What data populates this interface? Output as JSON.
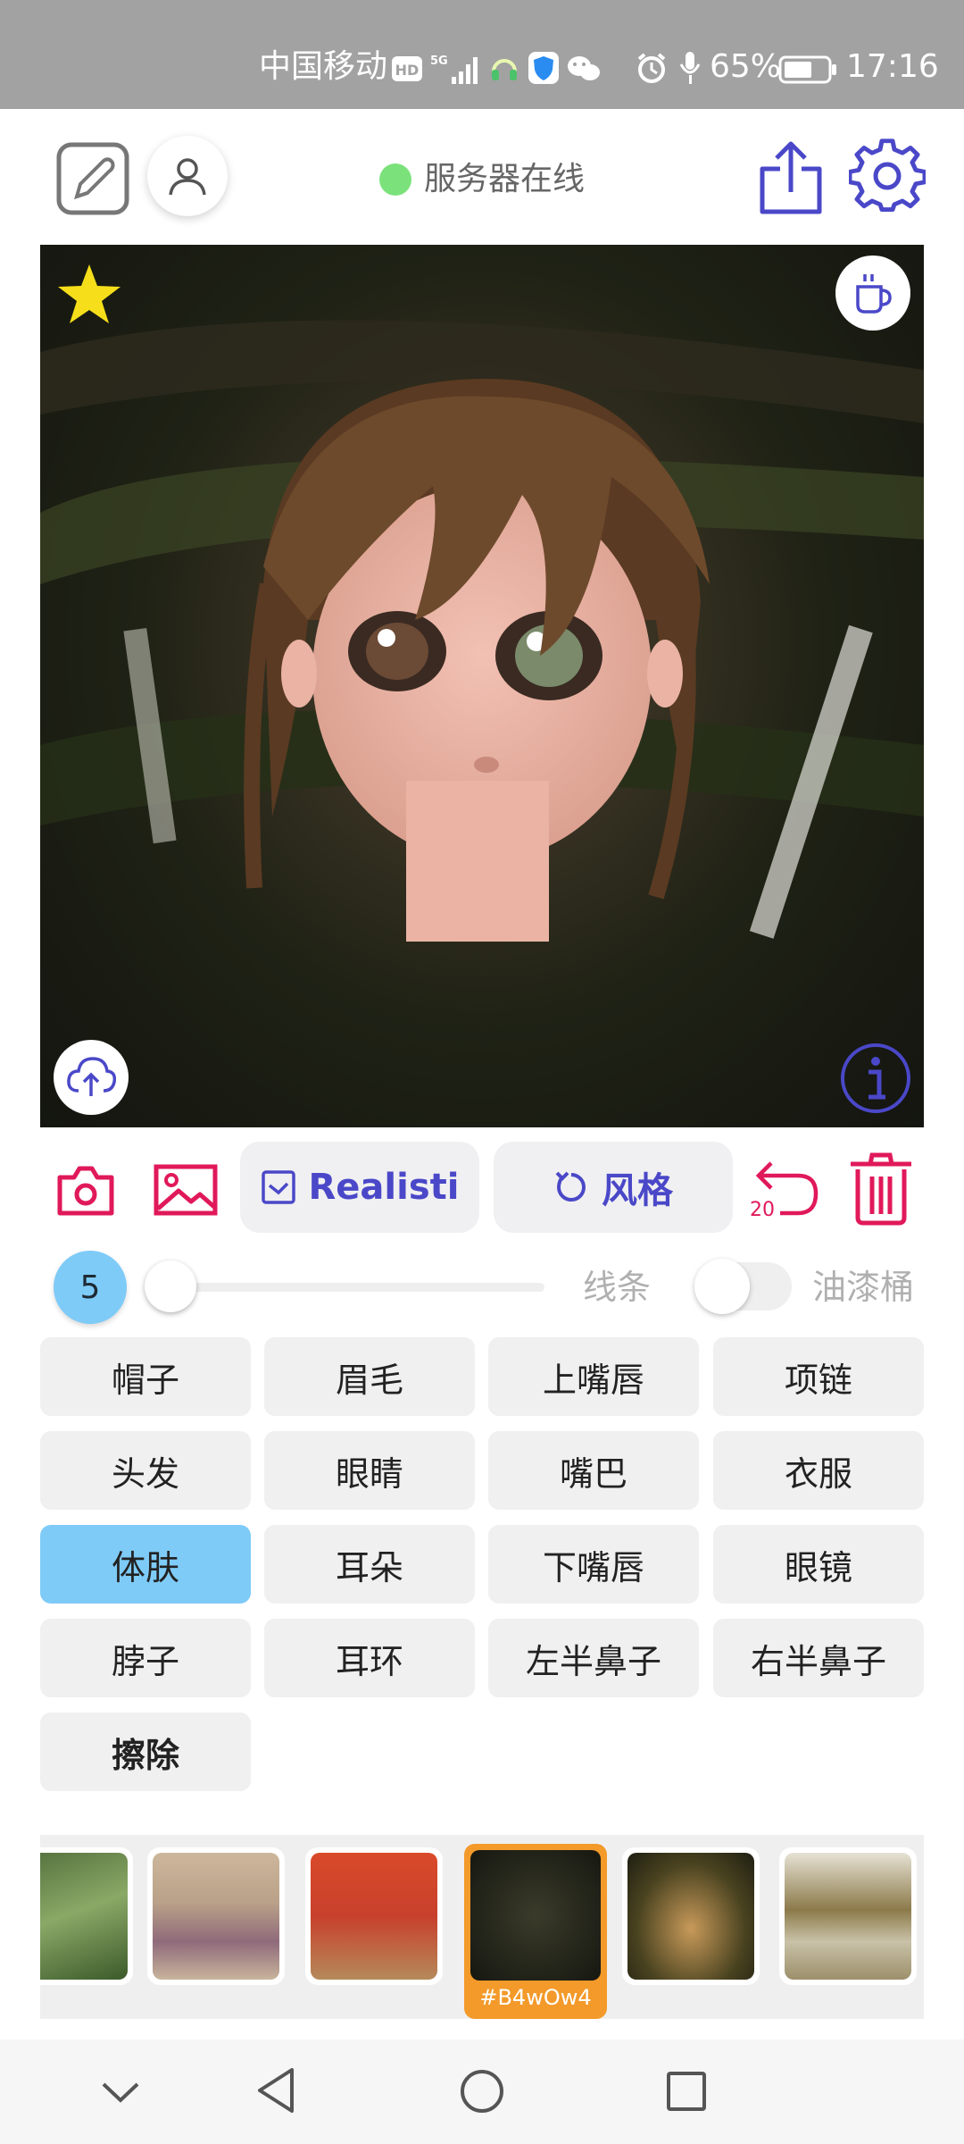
{
  "status_bar": {
    "carrier": "中国移动",
    "network": "5G",
    "battery": "65%",
    "time": "17:16",
    "icons": [
      "hd-icon",
      "signal-icon",
      "headset-icon",
      "shield-icon",
      "wechat-icon",
      "alarm-icon",
      "mic-icon",
      "battery-icon"
    ]
  },
  "header": {
    "server_status": "服务器在线",
    "server_status_color": "#7be27b"
  },
  "canvas": {
    "favorite": "star-icon",
    "coffee": "coffee-icon",
    "upload": "cloud-upload-icon",
    "info": "info-icon"
  },
  "actions": {
    "model_label": "Realisti",
    "style_label": "风格",
    "undo_count": "20"
  },
  "brush": {
    "size": "5",
    "level": 0,
    "line_label": "线条",
    "bucket_label": "油漆桶",
    "bucket_enabled": false
  },
  "parts": [
    {
      "label": "帽子"
    },
    {
      "label": "眉毛"
    },
    {
      "label": "上嘴唇"
    },
    {
      "label": "项链"
    },
    {
      "label": "头发"
    },
    {
      "label": "眼睛"
    },
    {
      "label": "嘴巴"
    },
    {
      "label": "衣服"
    },
    {
      "label": "体肤",
      "selected": true
    },
    {
      "label": "耳朵"
    },
    {
      "label": "下嘴唇"
    },
    {
      "label": "眼镜"
    },
    {
      "label": "脖子"
    },
    {
      "label": "耳环"
    },
    {
      "label": "左半鼻子"
    },
    {
      "label": "右半鼻子"
    },
    {
      "label": "擦除"
    }
  ],
  "thumbnails": {
    "selected_caption": "#B4wOw4"
  },
  "colors": {
    "accent_purple": "#4a48c8",
    "accent_red": "#e0195a",
    "selected_blue": "#7ecbf8",
    "thumb_selected": "#f39a2a"
  }
}
